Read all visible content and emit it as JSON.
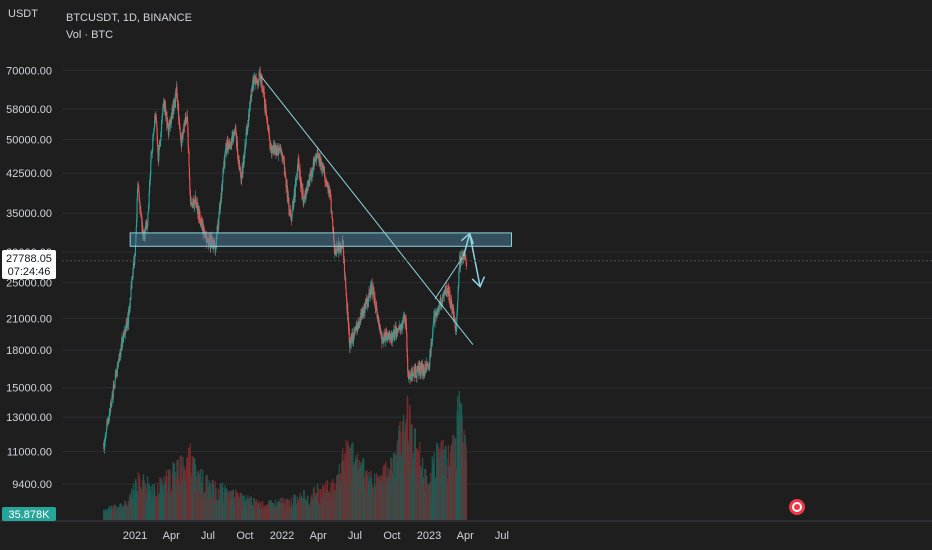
{
  "header": {
    "unit": "USDT",
    "symbol_line": "BTCUSDT, 1D, BINANCE",
    "volume_line": "Vol · BTC"
  },
  "price_tag": {
    "price": "27788.05",
    "countdown": "07:24:46"
  },
  "volume_tag": {
    "value": "35.878K"
  },
  "colors": {
    "background": "#1e1e1e",
    "up": "#26a69a",
    "down": "#ef5350",
    "vol_up": "#1b5e58",
    "vol_down": "#7a2b2e",
    "drawing": "#8fd3de",
    "zone_fill": "#4f8fb0",
    "price_tag_bg": "#ffffff",
    "volume_tag_bg": "#26a69a"
  },
  "chart_data": {
    "type": "candlestick",
    "x_ticks": [
      "2021",
      "Apr",
      "Jul",
      "Oct",
      "2022",
      "Apr",
      "Jul",
      "Oct",
      "2023",
      "Apr",
      "Jul"
    ],
    "y_ticks": [
      "70000.00",
      "58000.00",
      "50000.00",
      "42500.00",
      "35000.00",
      "29000.00",
      "25000.00",
      "21000.00",
      "18000.00",
      "15000.00",
      "13000.00",
      "11000.00",
      "9400.00"
    ],
    "y_scale": "log",
    "ylim": [
      8700,
      78000
    ],
    "price_path": [
      [
        "2020-10-15",
        11400
      ],
      [
        "2020-11-01",
        13700
      ],
      [
        "2020-11-15",
        16000
      ],
      [
        "2020-12-01",
        19000
      ],
      [
        "2020-12-15",
        21000
      ],
      [
        "2021-01-01",
        29000
      ],
      [
        "2021-01-08",
        40000
      ],
      [
        "2021-01-22",
        31000
      ],
      [
        "2021-02-01",
        33500
      ],
      [
        "2021-02-10",
        46000
      ],
      [
        "2021-02-21",
        57000
      ],
      [
        "2021-02-28",
        45000
      ],
      [
        "2021-03-13",
        61000
      ],
      [
        "2021-03-25",
        52000
      ],
      [
        "2021-04-14",
        63500
      ],
      [
        "2021-04-25",
        49000
      ],
      [
        "2021-05-10",
        57000
      ],
      [
        "2021-05-19",
        36000
      ],
      [
        "2021-06-01",
        37000
      ],
      [
        "2021-06-22",
        31500
      ],
      [
        "2021-07-20",
        29700
      ],
      [
        "2021-08-14",
        47500
      ],
      [
        "2021-09-07",
        52000
      ],
      [
        "2021-09-21",
        40500
      ],
      [
        "2021-10-20",
        66000
      ],
      [
        "2021-11-10",
        68000
      ],
      [
        "2021-12-04",
        48000
      ],
      [
        "2022-01-01",
        47000
      ],
      [
        "2022-01-24",
        33500
      ],
      [
        "2022-02-10",
        44500
      ],
      [
        "2022-02-24",
        37000
      ],
      [
        "2022-03-29",
        47500
      ],
      [
        "2022-05-01",
        38000
      ],
      [
        "2022-05-12",
        29000
      ],
      [
        "2022-06-01",
        30000
      ],
      [
        "2022-06-18",
        18500
      ],
      [
        "2022-07-01",
        19500
      ],
      [
        "2022-08-13",
        24500
      ],
      [
        "2022-09-06",
        19000
      ],
      [
        "2022-10-01",
        19300
      ],
      [
        "2022-11-05",
        21000
      ],
      [
        "2022-11-09",
        16000
      ],
      [
        "2022-12-31",
        16500
      ],
      [
        "2023-01-14",
        21000
      ],
      [
        "2023-02-16",
        24500
      ],
      [
        "2023-03-10",
        20000
      ],
      [
        "2023-03-17",
        27500
      ],
      [
        "2023-03-30",
        28500
      ],
      [
        "2023-04-04",
        27788
      ]
    ],
    "volume_scale": "relative",
    "volume_path": [
      [
        "2020-10-15",
        0.08
      ],
      [
        "2020-12-15",
        0.14
      ],
      [
        "2021-01-08",
        0.32
      ],
      [
        "2021-02-21",
        0.25
      ],
      [
        "2021-05-19",
        0.5
      ],
      [
        "2021-06-22",
        0.3
      ],
      [
        "2021-09-07",
        0.2
      ],
      [
        "2021-11-10",
        0.12
      ],
      [
        "2022-01-24",
        0.16
      ],
      [
        "2022-05-12",
        0.28
      ],
      [
        "2022-06-18",
        0.62
      ],
      [
        "2022-08-13",
        0.3
      ],
      [
        "2022-10-01",
        0.42
      ],
      [
        "2022-11-09",
        0.85
      ],
      [
        "2022-12-31",
        0.25
      ],
      [
        "2023-01-14",
        0.5
      ],
      [
        "2023-03-10",
        0.6
      ],
      [
        "2023-03-13",
        0.95
      ],
      [
        "2023-04-04",
        0.5
      ]
    ],
    "drawings": {
      "trendline": {
        "from": [
          "2021-11-10",
          68000
        ],
        "to": [
          "2023-04-20",
          18500
        ]
      },
      "support_zone": {
        "from_date": "2020-12-20",
        "to_date": "2023-07-25",
        "low": 29800,
        "high": 31800
      },
      "rising_wedge": {
        "from": [
          "2023-01-16",
          23100
        ],
        "to": [
          "2023-03-25",
          28200
        ]
      },
      "projection": [
        [
          "2023-03-28",
          28400
        ],
        [
          "2023-04-12",
          31700
        ],
        [
          "2023-05-08",
          24500
        ]
      ]
    }
  }
}
